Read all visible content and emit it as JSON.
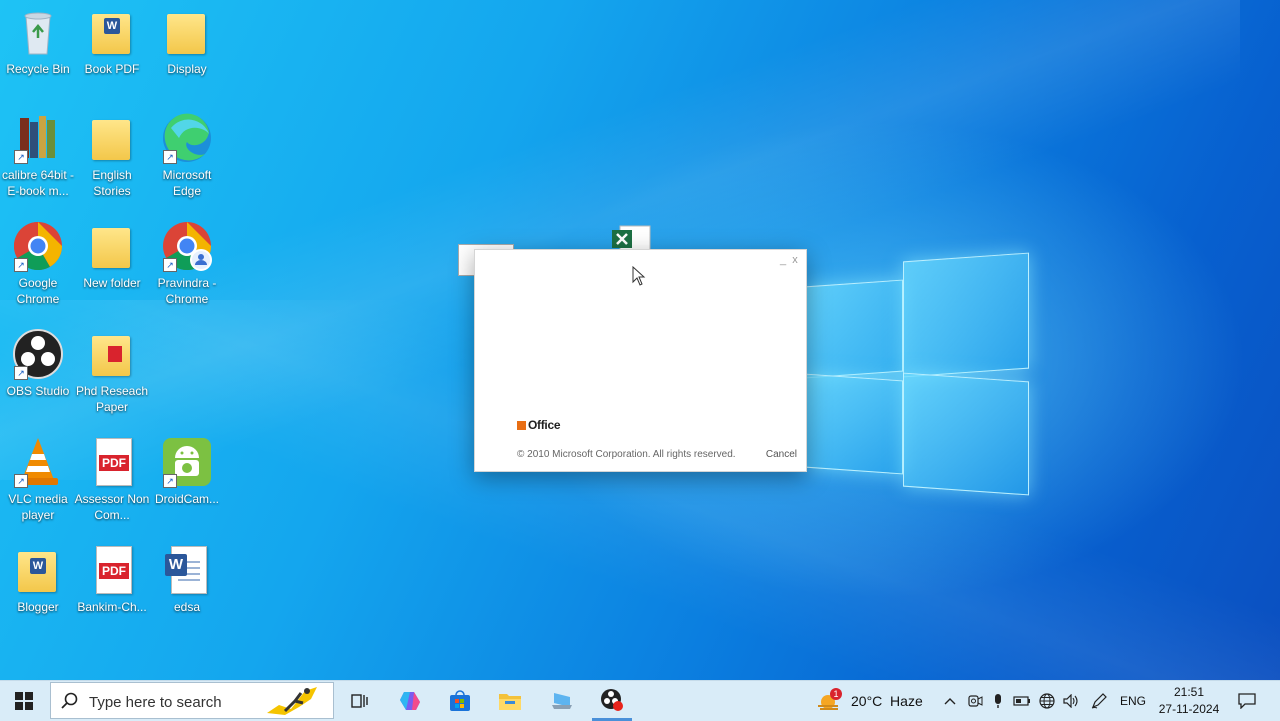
{
  "desktop_icons": [
    {
      "label": "Recycle Bin"
    },
    {
      "label": "Book PDF"
    },
    {
      "label": "Display"
    },
    {
      "label": "calibre 64bit - E-book m..."
    },
    {
      "label": "English Stories"
    },
    {
      "label": "Microsoft Edge"
    },
    {
      "label": "Google Chrome"
    },
    {
      "label": "New folder"
    },
    {
      "label": "Pravindra - Chrome"
    },
    {
      "label": "OBS Studio"
    },
    {
      "label": "Phd Reseach Paper"
    },
    {
      "label": "VLC media player"
    },
    {
      "label": "Assessor Non Com..."
    },
    {
      "label": "DroidCam..."
    },
    {
      "label": "Blogger"
    },
    {
      "label": "Bankim-Ch..."
    },
    {
      "label": "edsa"
    }
  ],
  "pdf_badge": "PDF",
  "dialog": {
    "minimize": "_",
    "close": "x",
    "logo_text": "Office",
    "copyright": "© 2010 Microsoft Corporation.  All rights reserved.",
    "cancel": "Cancel"
  },
  "taskbar": {
    "search_placeholder": "Type here to search",
    "weather": "20°C  Haze",
    "weather_badge": "1",
    "language": "ENG",
    "time": "21:51",
    "date": "27-11-2024"
  },
  "colors": {
    "accent": "#0078d4",
    "taskbar_bg": "#d9ecf8"
  }
}
